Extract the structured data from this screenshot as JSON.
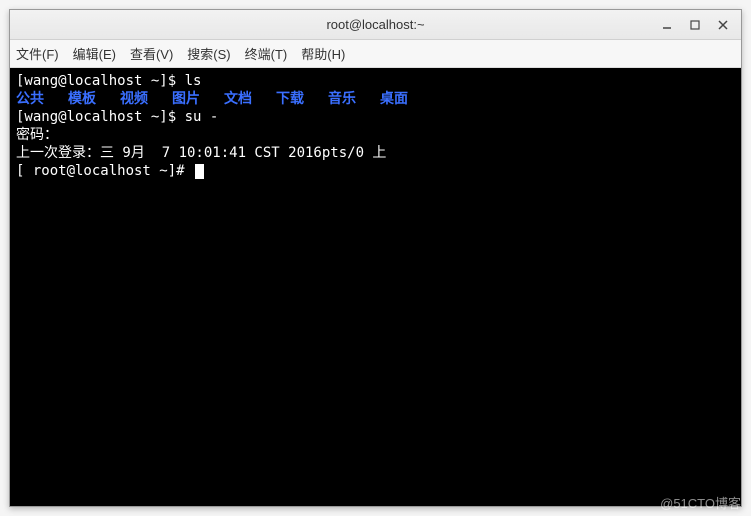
{
  "window": {
    "title": "root@localhost:~"
  },
  "menu": {
    "file": "文件(F)",
    "edit": "编辑(E)",
    "view": "查看(V)",
    "search": "搜索(S)",
    "terminal": "终端(T)",
    "help": "帮助(H)"
  },
  "terminal": {
    "line1_prompt": "[wang@localhost ~]$ ",
    "line1_cmd": "ls",
    "dirs": [
      "公共",
      "模板",
      "视频",
      "图片",
      "文档",
      "下载",
      "音乐",
      "桌面"
    ],
    "line3_prompt": "[wang@localhost ~]$ ",
    "line3_cmd": "su -",
    "line4": "密码：",
    "line5": "上一次登录：三 9月  7 10:01:41 CST 2016pts/0 上",
    "line6_prompt": "[ root@localhost ~]# "
  },
  "watermark": "@51CTO博客"
}
